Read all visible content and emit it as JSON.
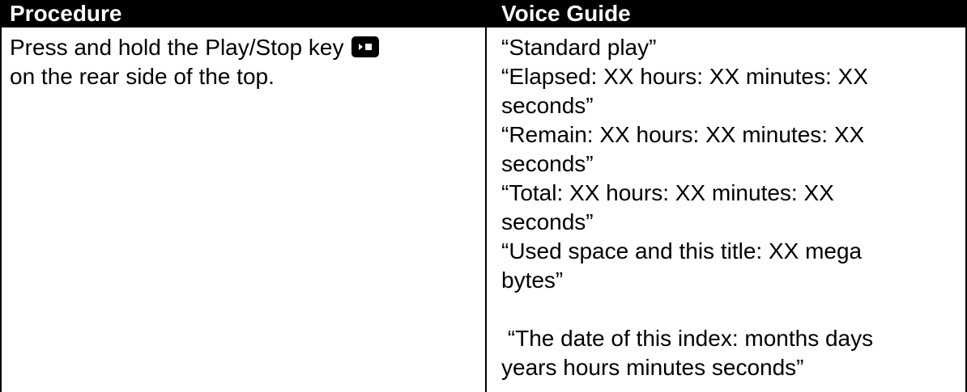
{
  "table": {
    "headers": {
      "procedure": "Procedure",
      "voice_guide": "Voice Guide"
    },
    "row": {
      "procedure_text_1": "Press and hold the Play/Stop key",
      "procedure_key_icon": "play-stop-key-icon",
      "procedure_text_2": "on the rear side of the top.",
      "voice_lines": [
        "“Standard play”",
        "“Elapsed: XX hours: XX minutes: XX",
        "seconds”",
        "“Remain: XX hours: XX minutes: XX",
        "seconds”",
        "“Total: XX hours: XX minutes: XX",
        "seconds”",
        "“Used space and this title: XX mega",
        "bytes”",
        "",
        " “The date of this index: months days",
        "years hours minutes seconds”"
      ]
    }
  },
  "colors": {
    "header_background": "#000000",
    "header_text": "#ffffff",
    "body_text": "#000000"
  }
}
